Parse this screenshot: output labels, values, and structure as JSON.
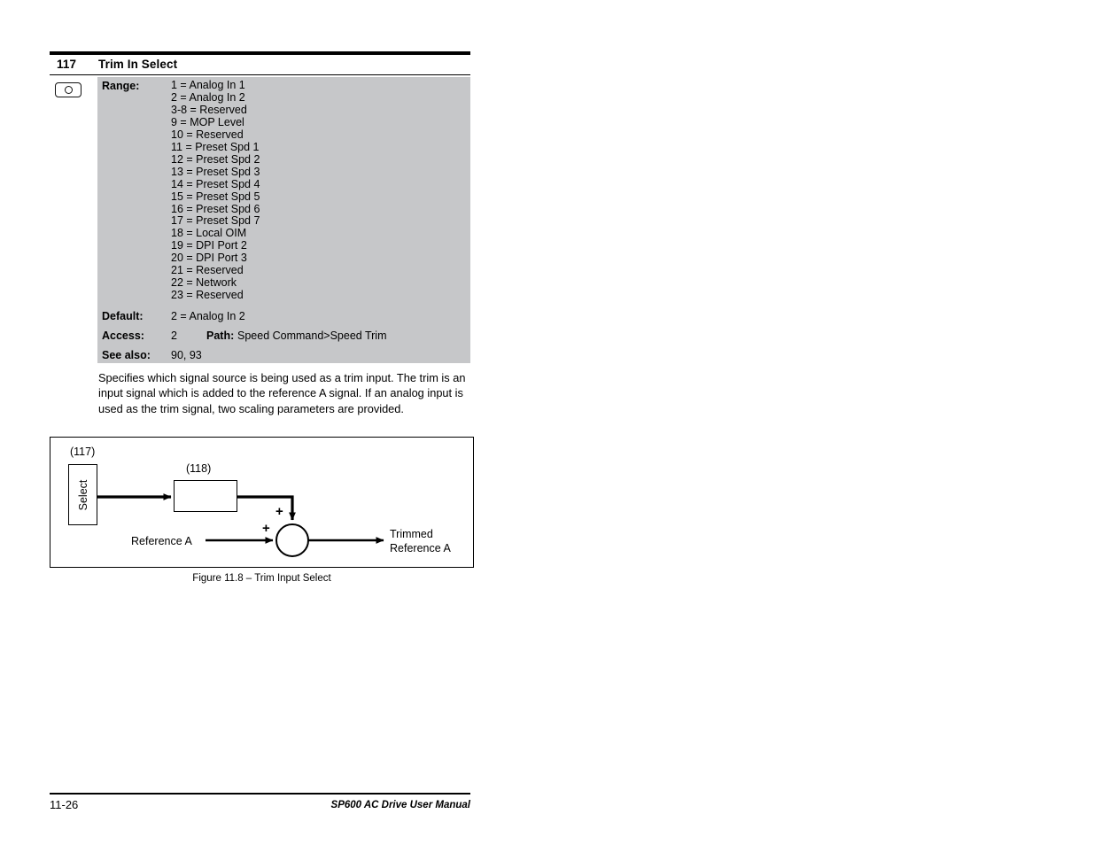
{
  "parameter": {
    "number": "117",
    "title": "Trim In Select",
    "icon": "read-only-parameter-icon",
    "labels": {
      "range": "Range:",
      "default": "Default:",
      "access": "Access:",
      "path": "Path:",
      "see_also": "See also:"
    },
    "range": [
      "1 = Analog In 1",
      "2 = Analog In 2",
      "3-8 = Reserved",
      "9 = MOP Level",
      "10 = Reserved",
      "11 = Preset Spd 1",
      "12 = Preset Spd 2",
      "13 = Preset Spd 3",
      "14 = Preset Spd 4",
      "15 = Preset Spd 5",
      "16 = Preset Spd 6",
      "17 = Preset Spd 7",
      "18 = Local OIM",
      "19 = DPI Port 2",
      "20 = DPI Port 3",
      "21 = Reserved",
      "22 = Network",
      "23 = Reserved"
    ],
    "default_value": "2 = Analog In 2",
    "access_value": "2",
    "path_value": "Speed Command>Speed Trim",
    "see_also_value": "90, 93",
    "description": "Specifies which signal source is being used as a trim input. The trim is an input signal which is added to the reference A signal. If an analog input is used as the trim signal, two scaling parameters are provided."
  },
  "figure": {
    "caption": "Figure 11.8 – Trim Input Select",
    "select_block_label": "(117)",
    "select_block_text": "Select",
    "switch_block_label": "(118)",
    "input_label": "Reference A",
    "output_label_line1": "Trimmed",
    "output_label_line2": "Reference A",
    "sum_sign_left": "+",
    "sum_sign_top": "+"
  },
  "footer": {
    "page_number": "11-26",
    "manual_title": "SP600 AC Drive User Manual"
  },
  "colors": {
    "spec_background": "#c6c7c9",
    "text": "#000000",
    "page_background": "#ffffff"
  }
}
